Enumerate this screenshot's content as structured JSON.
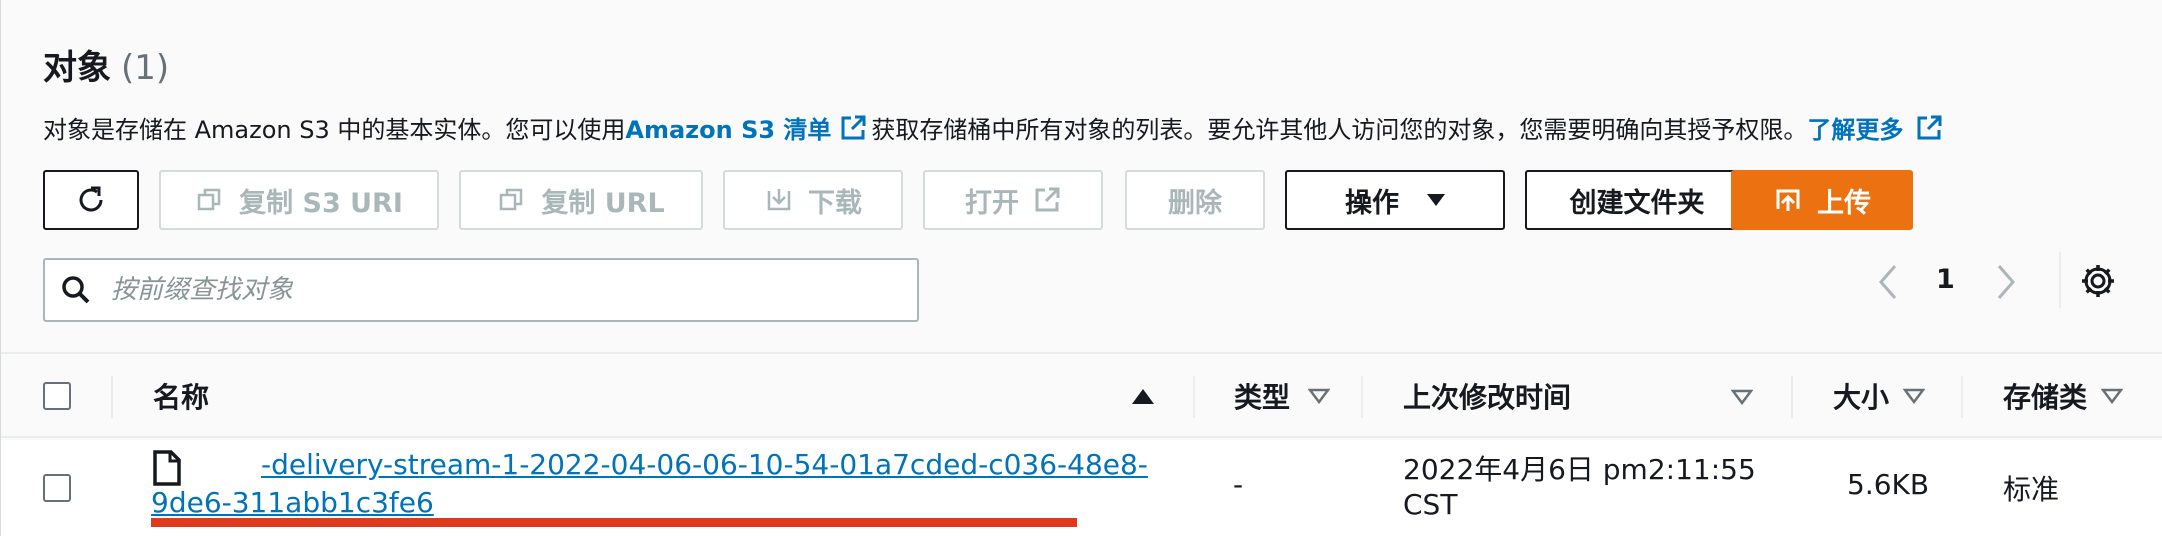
{
  "header": {
    "title": "对象",
    "count": "(1)"
  },
  "description": {
    "text1": "对象是存储在 Amazon S3 中的基本实体。您可以使用 ",
    "link1": "Amazon S3 清单",
    "text2": "获取存储桶中所有对象的列表。要允许其他人访问您的对象，您需要明确向其授予权限。",
    "link2": "了解更多"
  },
  "toolbar": {
    "refresh_icon": "refresh-icon",
    "copy_s3_uri": "复制 S3 URI",
    "copy_url": "复制 URL",
    "download": "下载",
    "open": "打开",
    "delete": "删除",
    "actions": "操作",
    "create_folder": "创建文件夹",
    "upload": "上传"
  },
  "search": {
    "placeholder": "按前缀查找对象"
  },
  "pagination": {
    "current_page": "1"
  },
  "table": {
    "columns": {
      "name": "名称",
      "type": "类型",
      "last_modified": "上次修改时间",
      "size": "大小",
      "storage_class": "存储类"
    },
    "rows": [
      {
        "name_line1": "-delivery-stream-1-2022-04-06-06-10-54-01a7cded-c036-48e8-",
        "name_line2": "9de6-311abb1c3fe6",
        "type": "-",
        "last_modified_line1": "2022年4月6日 pm2:11:55",
        "last_modified_line2": "CST",
        "size": "5.6KB",
        "storage_class": "标准"
      }
    ]
  },
  "colors": {
    "link": "#0073bb",
    "primary": "#ec7211",
    "annotation": "#e0391d"
  }
}
